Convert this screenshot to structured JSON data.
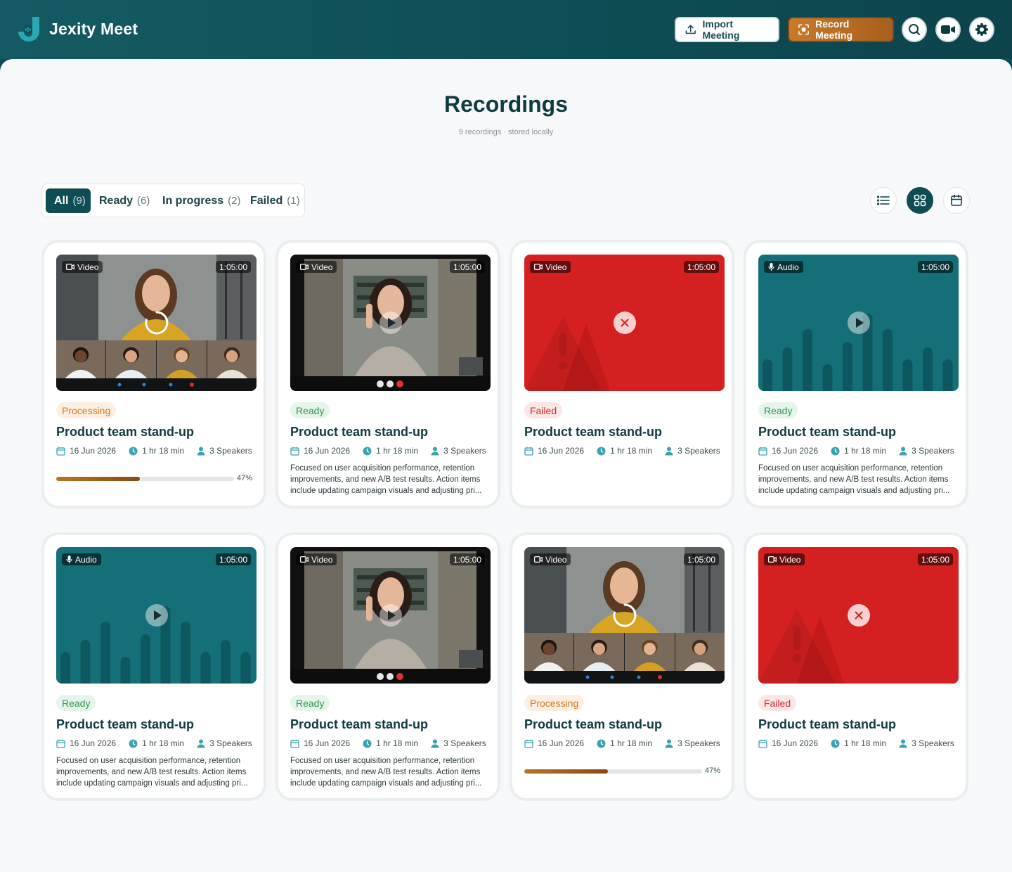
{
  "app": {
    "name": "Jexity Meet"
  },
  "header": {
    "import_label": "Import Meeting",
    "record_label": "Record Meeting"
  },
  "page": {
    "title": "Recordings",
    "subtitle": "9 recordings · stored locally"
  },
  "filters": [
    {
      "label": "All",
      "count": "(9)",
      "active": true
    },
    {
      "label": "Ready",
      "count": "(6)",
      "active": false
    },
    {
      "label": "In progress",
      "count": "(2)",
      "active": false
    },
    {
      "label": "Failed",
      "count": "(1)",
      "active": false
    }
  ],
  "colors": {
    "brand": "#0f4d55",
    "accent": "#c67b2a",
    "failed": "#d42020",
    "audio_bg": "#156f78"
  },
  "cards": [
    {
      "kind": "Video",
      "duration": "1:05:00",
      "status": "Processing",
      "thumb": "grid",
      "title": "Product team stand-up",
      "date": "16 Jun 2026",
      "length": "1 hr 18 min",
      "speakers": "3 Speakers",
      "progress": 0.47,
      "progress_label": "47%"
    },
    {
      "kind": "Video",
      "duration": "1:05:00",
      "status": "Ready",
      "thumb": "call",
      "title": "Product team stand-up",
      "date": "16 Jun 2026",
      "length": "1 hr 18 min",
      "speakers": "3 Speakers",
      "description": "Focused on user acquisition performance, retention improvements, and new A/B test results. Action items include updating campaign visuals and adjusting pri..."
    },
    {
      "kind": "Video",
      "duration": "1:05:00",
      "status": "Failed",
      "thumb": "failed",
      "title": "Product team stand-up",
      "date": "16 Jun 2026",
      "length": "1 hr 18 min",
      "speakers": "3 Speakers"
    },
    {
      "kind": "Audio",
      "duration": "1:05:00",
      "status": "Ready",
      "thumb": "audio",
      "title": "Product team stand-up",
      "date": "16 Jun 2026",
      "length": "1 hr 18 min",
      "speakers": "3 Speakers",
      "description": "Focused on user acquisition performance, retention improvements, and new A/B test results. Action items include updating campaign visuals and adjusting pri..."
    },
    {
      "kind": "Audio",
      "duration": "1:05:00",
      "status": "Ready",
      "thumb": "audio",
      "title": "Product team stand-up",
      "date": "16 Jun 2026",
      "length": "1 hr 18 min",
      "speakers": "3 Speakers",
      "description": "Focused on user acquisition performance, retention improvements, and new A/B test results. Action items include updating campaign visuals and adjusting pri..."
    },
    {
      "kind": "Video",
      "duration": "1:05:00",
      "status": "Ready",
      "thumb": "call",
      "title": "Product team stand-up",
      "date": "16 Jun 2026",
      "length": "1 hr 18 min",
      "speakers": "3 Speakers",
      "description": "Focused on user acquisition performance, retention improvements, and new A/B test results. Action items include updating campaign visuals and adjusting pri..."
    },
    {
      "kind": "Video",
      "duration": "1:05:00",
      "status": "Processing",
      "thumb": "grid",
      "title": "Product team stand-up",
      "date": "16 Jun 2026",
      "length": "1 hr 18 min",
      "speakers": "3 Speakers",
      "progress": 0.47,
      "progress_label": "47%"
    },
    {
      "kind": "Video",
      "duration": "1:05:00",
      "status": "Failed",
      "thumb": "failed",
      "title": "Product team stand-up",
      "date": "16 Jun 2026",
      "length": "1 hr 18 min",
      "speakers": "3 Speakers"
    }
  ]
}
